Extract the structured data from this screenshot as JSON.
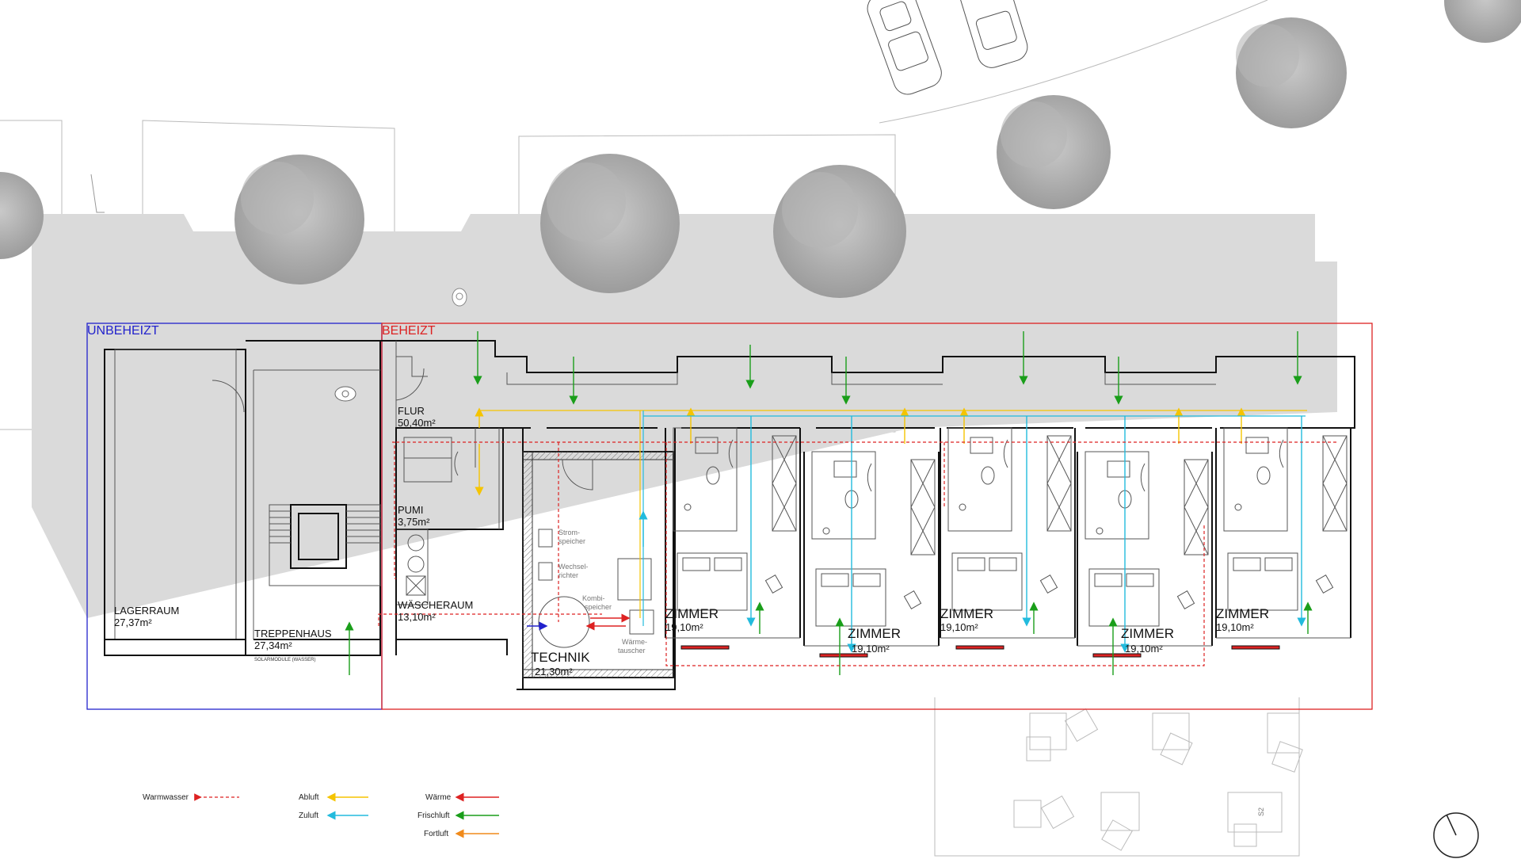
{
  "zones": {
    "unheated": {
      "label": "UNBEHEIZT",
      "color": "#2222cc"
    },
    "heated": {
      "label": "BEHEIZT",
      "color": "#dd2222"
    }
  },
  "rooms": {
    "lagerraum": {
      "name": "LAGERRAUM",
      "area": "27,37m²"
    },
    "treppenhaus": {
      "name": "TREPPENHAUS",
      "area": "27,34m²",
      "note": "SOLARMODULE (WASSER)"
    },
    "flur": {
      "name": "FLUR",
      "area": "50,40m²"
    },
    "pumi": {
      "name": "PUMI",
      "area": "3,75m²"
    },
    "waescheraum": {
      "name": "WÄSCHERAUM",
      "area": "13,10m²"
    },
    "technik": {
      "name": "TECHNIK",
      "area": "21,30m²"
    },
    "zimmer": [
      {
        "name": "ZIMMER",
        "area": "19,10m²"
      },
      {
        "name": "ZIMMER",
        "area": "19,10m²"
      },
      {
        "name": "ZIMMER",
        "area": "19,10m²"
      },
      {
        "name": "ZIMMER",
        "area": "19,10m²"
      },
      {
        "name": "ZIMMER",
        "area": "19,10m²"
      }
    ]
  },
  "equipment": {
    "stromspeicher": [
      "Strom-",
      "speicher"
    ],
    "wechselrichter": [
      "Wechsel-",
      "richter"
    ],
    "kombispeicher": [
      "Kombi-",
      "speicher"
    ],
    "waermetauscher": [
      "Wärme-",
      "tauscher"
    ]
  },
  "legend": {
    "warmwasser": {
      "label": "Warmwasser",
      "color": "#dd2222"
    },
    "abluft": {
      "label": "Abluft",
      "color": "#f5c400"
    },
    "zuluft": {
      "label": "Zuluft",
      "color": "#22bbdd"
    },
    "waerme": {
      "label": "Wärme",
      "color": "#dd2222"
    },
    "frischluft": {
      "label": "Frischluft",
      "color": "#1a9e1a"
    },
    "fortluft": {
      "label": "Fortluft",
      "color": "#f08a1a"
    }
  },
  "site": {
    "parking_label": "S2"
  }
}
